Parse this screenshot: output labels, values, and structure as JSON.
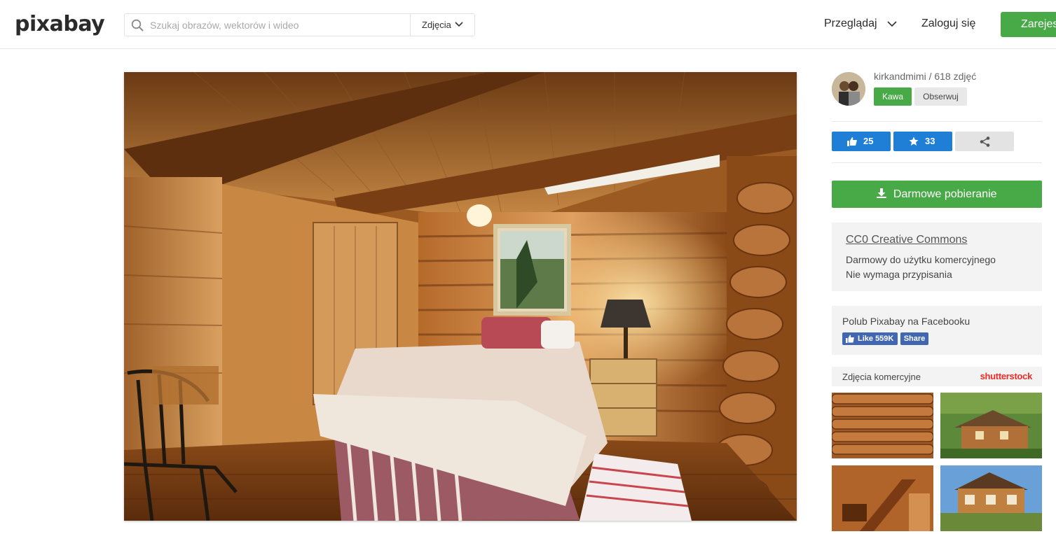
{
  "header": {
    "logo": "pixabay",
    "search_placeholder": "Szukaj obrazów, wektorów i wideo",
    "search_type": "Zdjęcia",
    "browse": "Przeglądaj",
    "login": "Zaloguj się",
    "join": "Zarejes"
  },
  "photo": {
    "icon": "bedroom-photo"
  },
  "author": {
    "name_line": "kirkandmimi / 618 zdjęć",
    "coffee": "Kawa",
    "follow": "Obserwuj"
  },
  "stats": {
    "likes": "25",
    "favorites": "33"
  },
  "download": {
    "label": "Darmowe pobieranie"
  },
  "license": {
    "title": "CC0 Creative Commons",
    "line1": "Darmowy do użytku komercyjnego",
    "line2": "Nie wymaga przypisania"
  },
  "facebook": {
    "text": "Polub Pixabay na Facebooku",
    "like": "Like 559K",
    "share": "Share"
  },
  "commercial": {
    "label": "Zdjęcia komercyjne",
    "brand": "shutterstock"
  },
  "colors": {
    "green": "#48a947",
    "blue": "#1f7fd6",
    "facebook": "#4267b2",
    "shutterstock": "#ee2b24"
  }
}
